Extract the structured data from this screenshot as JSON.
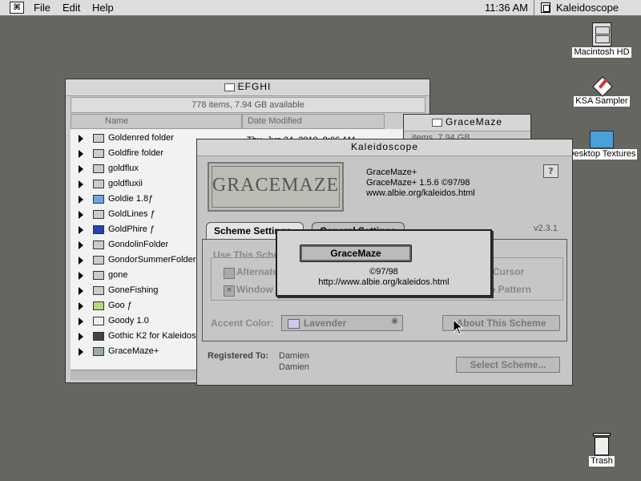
{
  "menubar": {
    "apple_label": "⌘",
    "menus": [
      "File",
      "Edit",
      "Help"
    ],
    "clock": "11:36 AM",
    "active_app": "Kaleidoscope"
  },
  "desktop": {
    "icons": [
      {
        "label": "Macintosh HD",
        "icon": "hard-disk-icon"
      },
      {
        "label": "KSA Sampler",
        "icon": "application-icon"
      },
      {
        "label": "Desktop Textures",
        "icon": "folder-icon"
      },
      {
        "label": "Trash",
        "icon": "trash-icon"
      }
    ]
  },
  "finder": {
    "title": "EFGHI",
    "info": "778 items, 7.94 GB available",
    "col_name": "Name",
    "col_date": "Date Modified",
    "date_fragment": "Thu, Jun 24, 2010, 8:06 AM",
    "items": [
      {
        "name": "Goldenred folder",
        "icon": "folder-icon"
      },
      {
        "name": "Goldfire folder",
        "icon": "folder-icon"
      },
      {
        "name": "goldflux",
        "icon": "folder-icon"
      },
      {
        "name": "goldfluxii",
        "icon": "folder-icon"
      },
      {
        "name": "Goldie 1.8ƒ",
        "icon": "folder-icon"
      },
      {
        "name": "GoldLines ƒ",
        "icon": "folder-icon"
      },
      {
        "name": "GoldPhire ƒ",
        "icon": "folder-icon"
      },
      {
        "name": "GondolinFolder",
        "icon": "folder-icon"
      },
      {
        "name": "GondorSummerFolder",
        "icon": "folder-icon"
      },
      {
        "name": "gone",
        "icon": "folder-icon"
      },
      {
        "name": "GoneFishing",
        "icon": "folder-icon"
      },
      {
        "name": "Goo ƒ",
        "icon": "folder-icon"
      },
      {
        "name": "Goody 1.0",
        "icon": "folder-icon"
      },
      {
        "name": "Gothic K2 for Kaleidoscope",
        "icon": "folder-icon"
      },
      {
        "name": "GraceMaze+",
        "icon": "folder-icon"
      }
    ]
  },
  "gracemaze_window": {
    "title": "GraceMaze",
    "info_fragment": "items, 7.94 GB"
  },
  "kaleidoscope": {
    "title": "Kaleidoscope",
    "logo_text": "GRACEMAZE",
    "scheme_name": "GraceMaze+",
    "scheme_version": "GraceMaze+ 1.5.6 ©97/98",
    "scheme_url": "www.albie.org/kaleidos.html",
    "help_label": "?",
    "app_version": "v2.3.1",
    "tab_scheme": "Scheme Settings",
    "tab_general": "General Settings",
    "use_this_scheme": "Use This Scheme's",
    "opt_alternate": "Alternate Menus",
    "opt_window": "Window Colors",
    "opt_cursor": "Cursor",
    "opt_pattern": "Desktop Pattern",
    "accent_label": "Accent Color:",
    "accent_value": "Lavender",
    "about_button": "About This Scheme",
    "registered_label": "Registered To:",
    "registered_name1": "Damien",
    "registered_name2": "Damien",
    "select_button": "Select Scheme..."
  },
  "about_popup": {
    "name": "GraceMaze",
    "copyright": "©97/98",
    "url": "http://www.albie.org/kaleidos.html"
  }
}
